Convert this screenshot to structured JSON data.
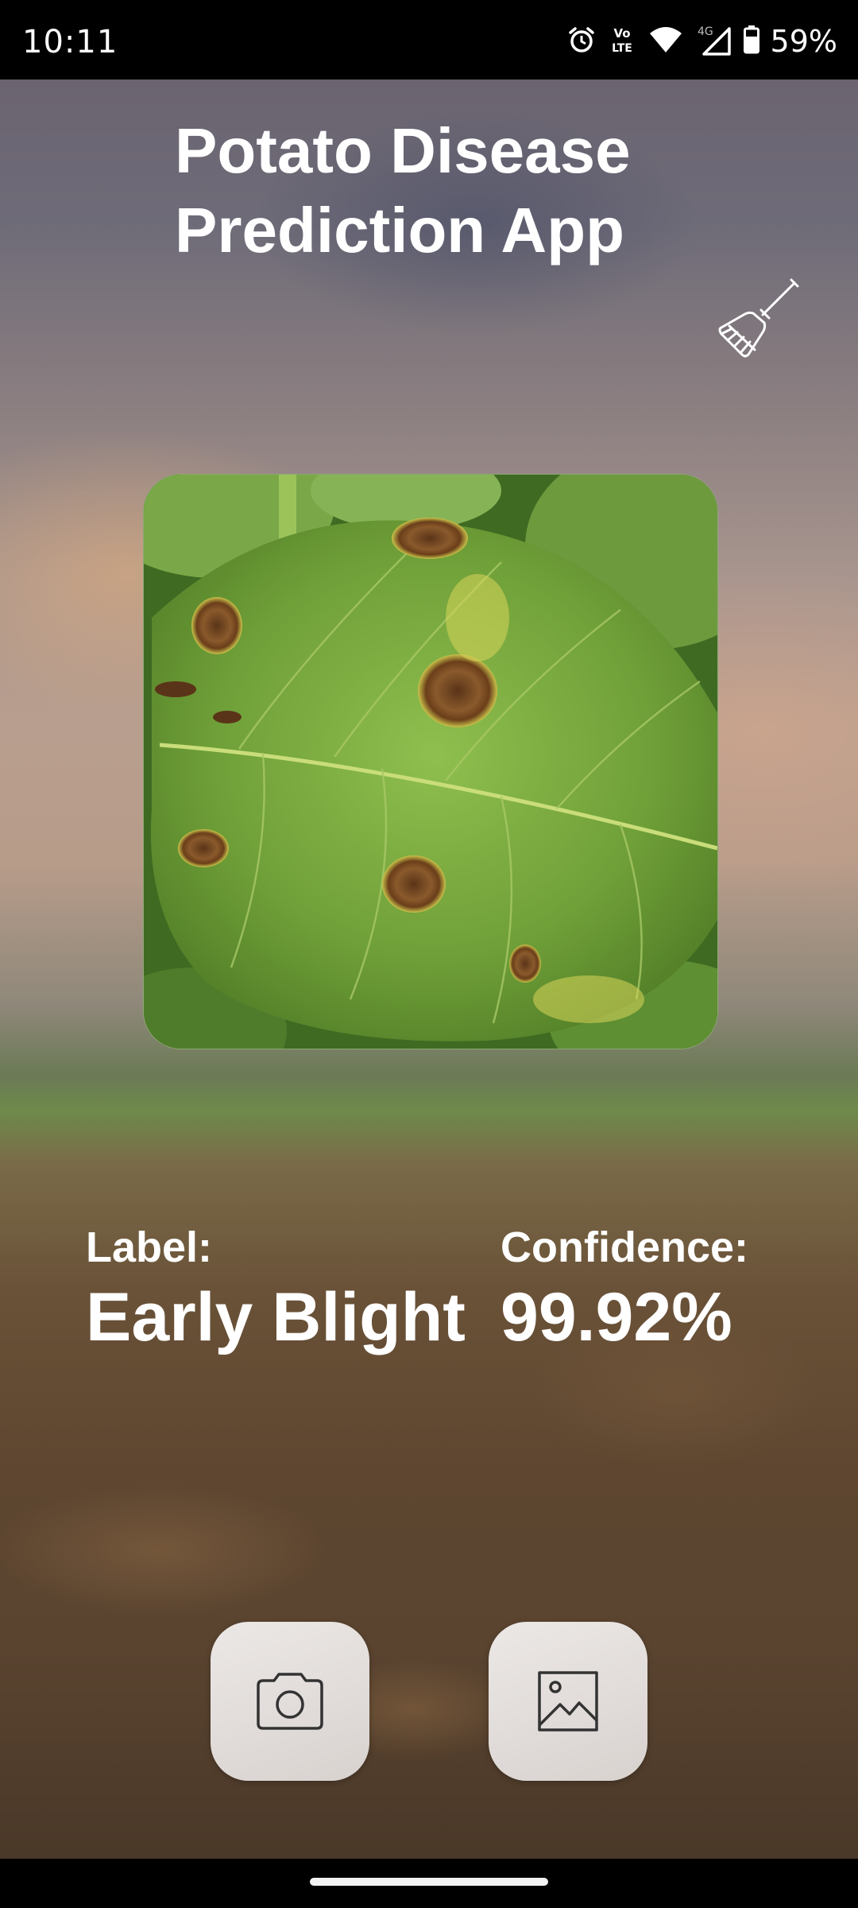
{
  "status_bar": {
    "time": "10:11",
    "network_type": "4G",
    "volte_label_top": "Vo",
    "volte_label_bottom": "LTE",
    "battery": "59%",
    "icons": [
      "alarm-icon",
      "volte-icon",
      "wifi-icon",
      "signal-icon",
      "battery-icon"
    ]
  },
  "app": {
    "title_line1": "Potato Disease",
    "title_line2": "Prediction App",
    "clear_icon": "broom-icon"
  },
  "image": {
    "subject": "potato-leaf-image"
  },
  "result": {
    "label_key": "Label:",
    "label_value": "Early Blight",
    "confidence_key": "Confidence:",
    "confidence_value": "99.92%"
  },
  "actions": {
    "camera_icon": "camera-icon",
    "gallery_icon": "gallery-icon"
  },
  "colors": {
    "text": "#ffffff",
    "button_bg": "#e6e1de",
    "leaf_green": "#6fa13a"
  }
}
